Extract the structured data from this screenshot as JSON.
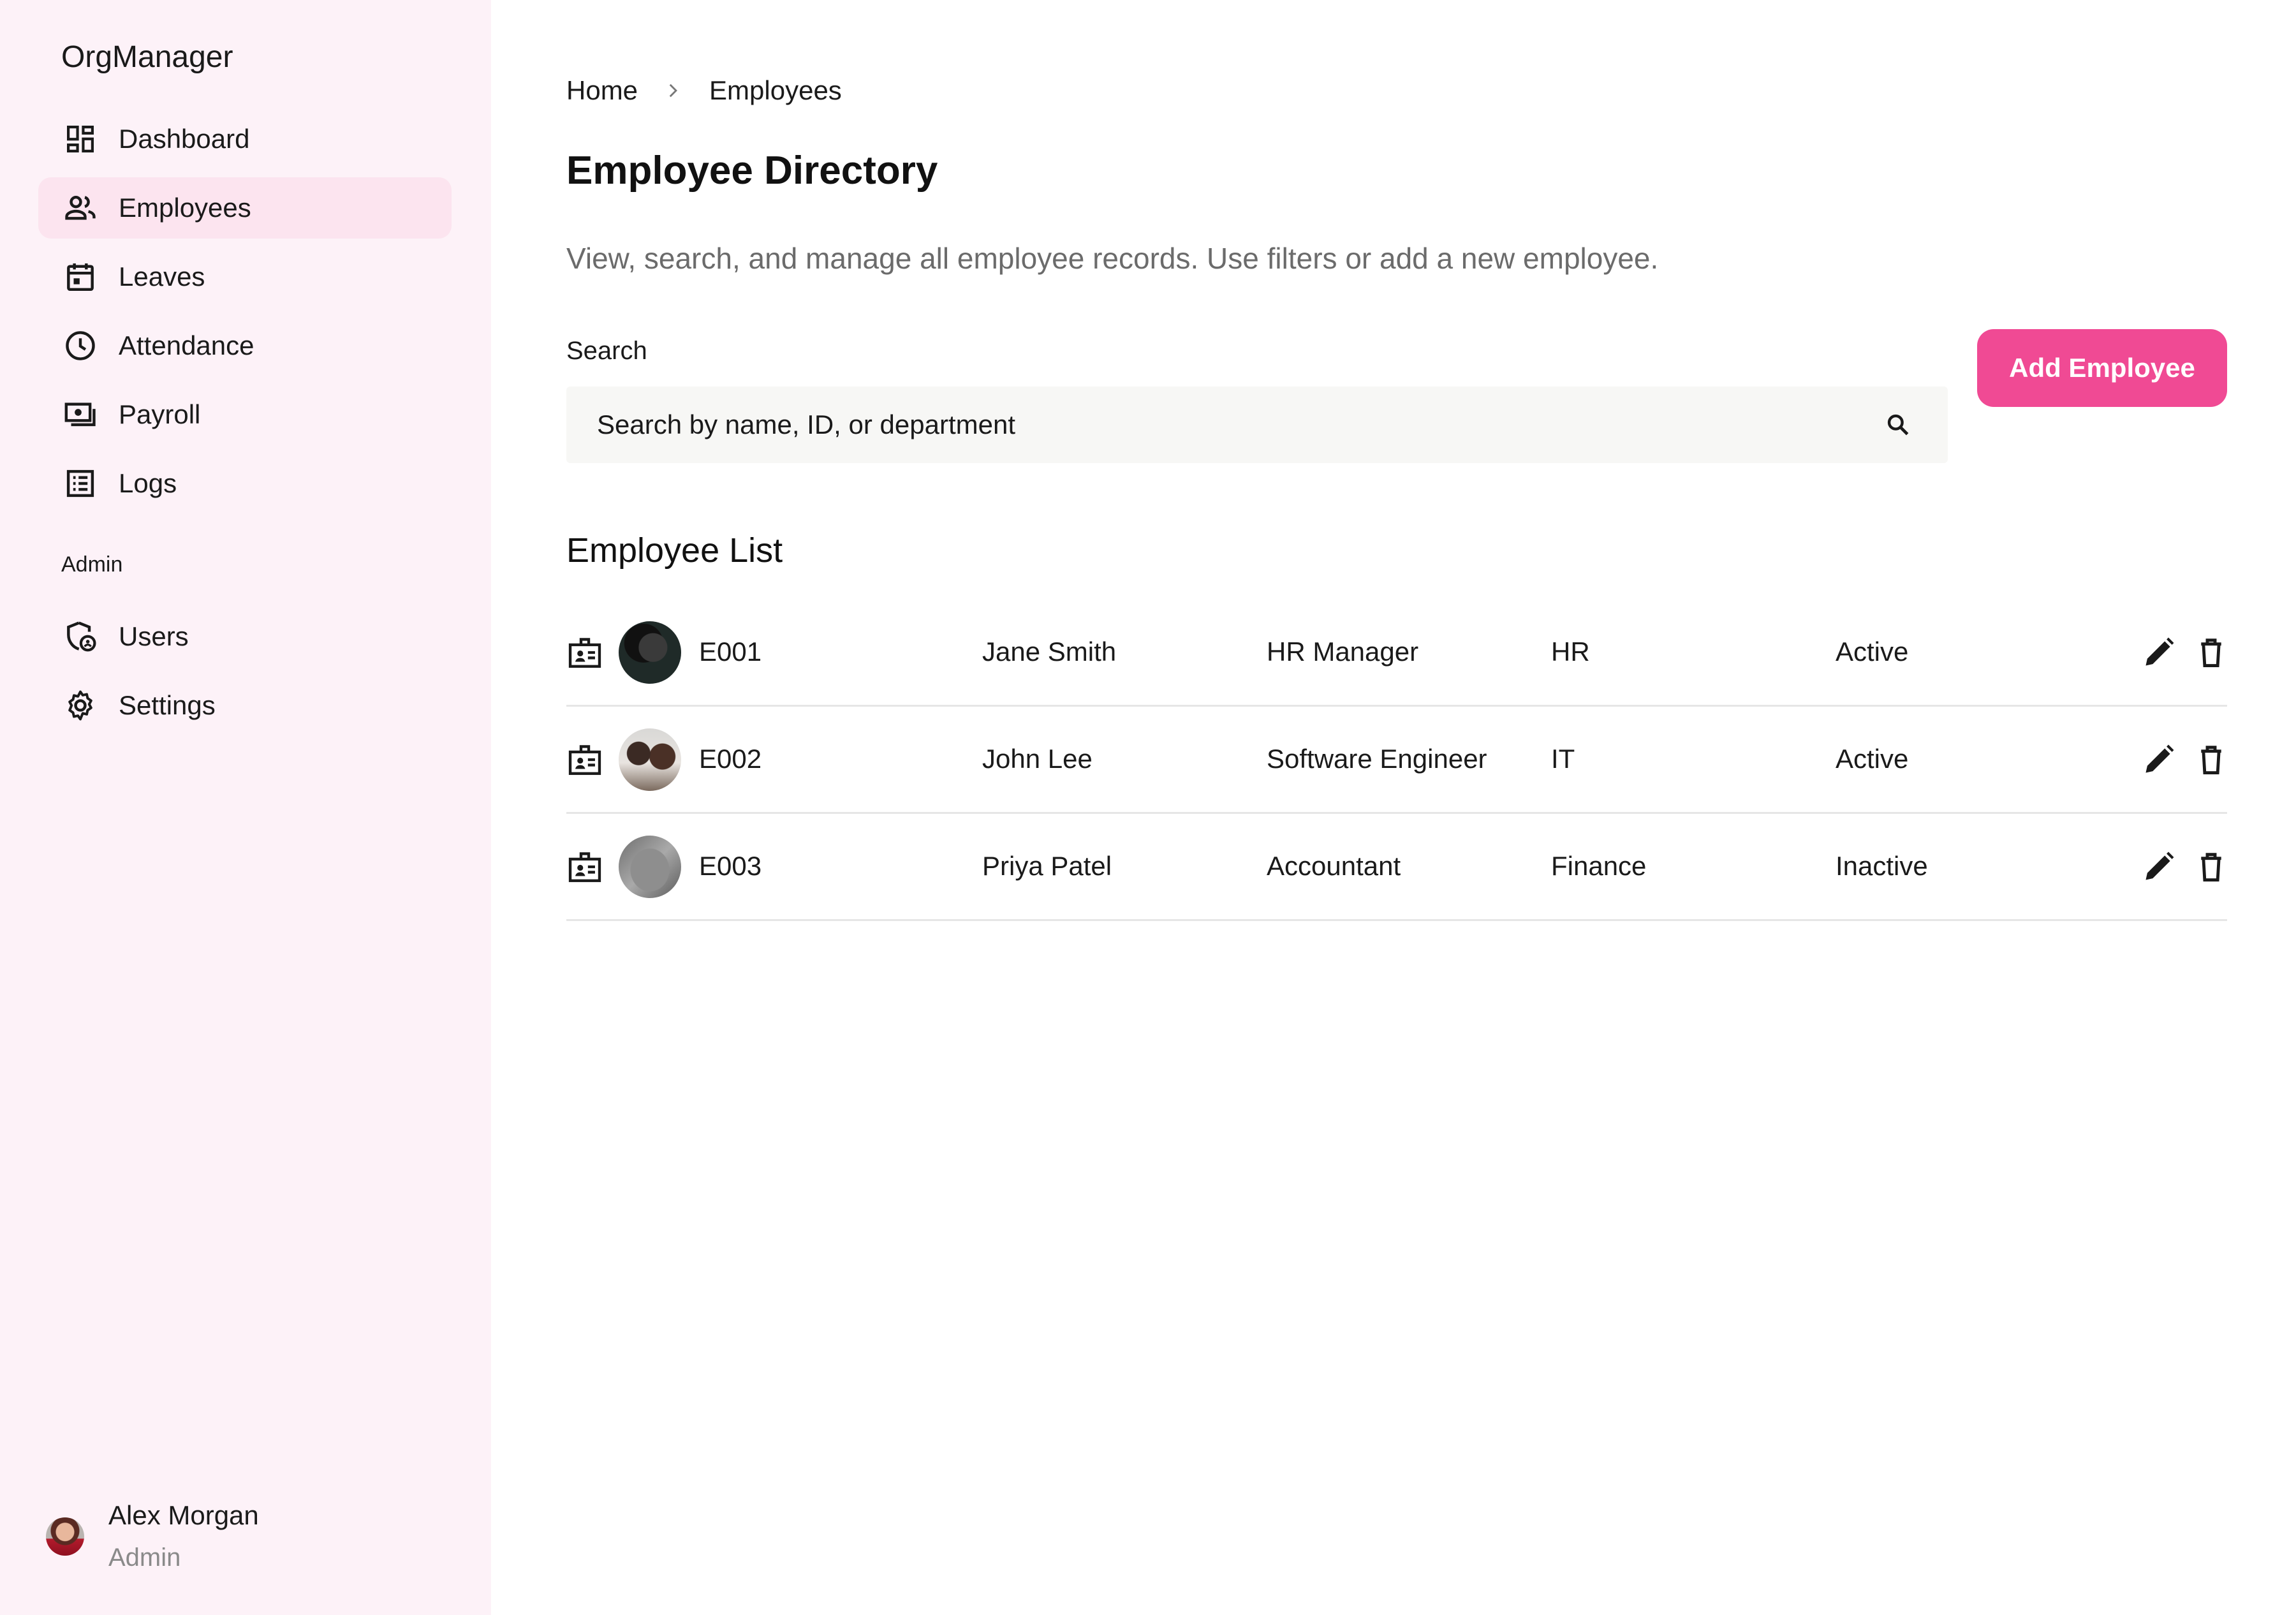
{
  "app": {
    "name": "OrgManager"
  },
  "sidebar": {
    "items": [
      {
        "label": "Dashboard",
        "icon": "dashboard-icon",
        "active": false
      },
      {
        "label": "Employees",
        "icon": "people-icon",
        "active": true
      },
      {
        "label": "Leaves",
        "icon": "calendar-icon",
        "active": false
      },
      {
        "label": "Attendance",
        "icon": "clock-icon",
        "active": false
      },
      {
        "label": "Payroll",
        "icon": "payments-icon",
        "active": false
      },
      {
        "label": "Logs",
        "icon": "list-icon",
        "active": false
      }
    ],
    "admin_section_label": "Admin",
    "admin_items": [
      {
        "label": "Users",
        "icon": "user-shield-icon"
      },
      {
        "label": "Settings",
        "icon": "gear-icon"
      }
    ],
    "profile": {
      "name": "Alex Morgan",
      "role": "Admin"
    }
  },
  "breadcrumb": {
    "home": "Home",
    "current": "Employees"
  },
  "page": {
    "title": "Employee Directory",
    "description": "View, search, and manage all employee records. Use filters or add a new employee."
  },
  "search": {
    "label": "Search",
    "placeholder": "Search by name, ID, or department",
    "value": ""
  },
  "actions": {
    "add_employee": "Add Employee"
  },
  "employee_list": {
    "title": "Employee List",
    "rows": [
      {
        "id": "E001",
        "name": "Jane Smith",
        "role": "HR Manager",
        "department": "HR",
        "status": "Active"
      },
      {
        "id": "E002",
        "name": "John Lee",
        "role": "Software Engineer",
        "department": "IT",
        "status": "Active"
      },
      {
        "id": "E003",
        "name": "Priya Patel",
        "role": "Accountant",
        "department": "Finance",
        "status": "Inactive"
      }
    ]
  },
  "colors": {
    "sidebar_bg": "#fdf2f8",
    "active_item_bg": "#fce4ef",
    "accent": "#f04a94"
  }
}
